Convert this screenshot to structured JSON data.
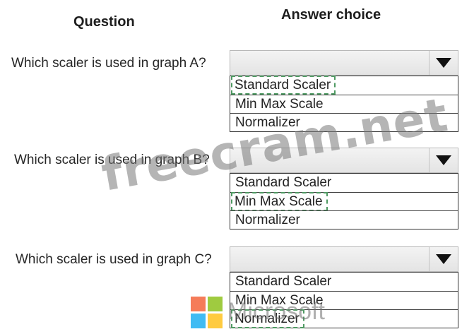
{
  "headers": {
    "question": "Question",
    "answer": "Answer choice"
  },
  "questions": [
    {
      "text": "Which scaler is used in graph A?",
      "selected_index": 0,
      "options": [
        "Standard Scaler",
        "Min Max Scale",
        "Normalizer"
      ]
    },
    {
      "text": "Which scaler is used in graph B?",
      "selected_index": 1,
      "options": [
        "Standard Scaler",
        "Min Max Scale",
        "Normalizer"
      ]
    },
    {
      "text": "Which scaler is used in graph C?",
      "selected_index": 2,
      "options": [
        "Standard Scaler",
        "Min Max Scale",
        "Normalizer"
      ]
    }
  ],
  "watermark": {
    "text": "freecram.net",
    "brand": "Microsoft"
  }
}
